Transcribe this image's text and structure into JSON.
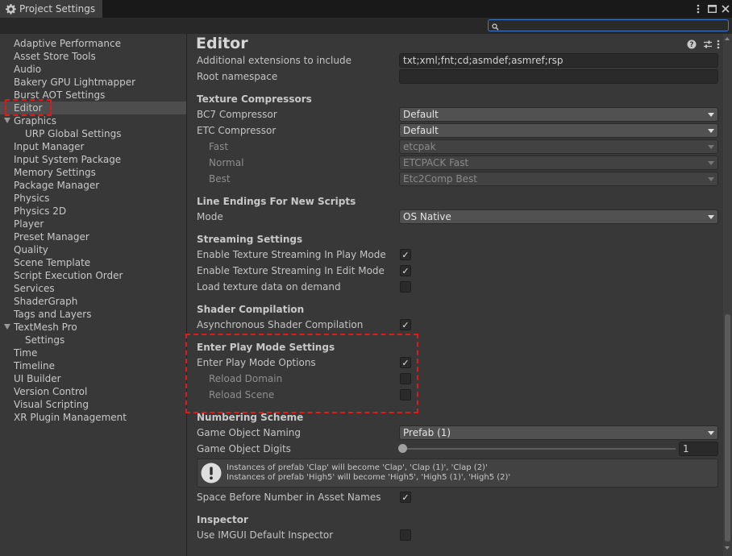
{
  "window": {
    "tab_title": "Project Settings"
  },
  "search": {
    "value": ""
  },
  "sidebar": {
    "items": [
      {
        "label": "Adaptive Performance"
      },
      {
        "label": "Asset Store Tools"
      },
      {
        "label": "Audio"
      },
      {
        "label": "Bakery GPU Lightmapper"
      },
      {
        "label": "Burst AOT Settings"
      },
      {
        "label": "Editor"
      },
      {
        "label": "Graphics"
      },
      {
        "label": "URP Global Settings"
      },
      {
        "label": "Input Manager"
      },
      {
        "label": "Input System Package"
      },
      {
        "label": "Memory Settings"
      },
      {
        "label": "Package Manager"
      },
      {
        "label": "Physics"
      },
      {
        "label": "Physics 2D"
      },
      {
        "label": "Player"
      },
      {
        "label": "Preset Manager"
      },
      {
        "label": "Quality"
      },
      {
        "label": "Scene Template"
      },
      {
        "label": "Script Execution Order"
      },
      {
        "label": "Services"
      },
      {
        "label": "ShaderGraph"
      },
      {
        "label": "Tags and Layers"
      },
      {
        "label": "TextMesh Pro"
      },
      {
        "label": "Settings"
      },
      {
        "label": "Time"
      },
      {
        "label": "Timeline"
      },
      {
        "label": "UI Builder"
      },
      {
        "label": "Version Control"
      },
      {
        "label": "Visual Scripting"
      },
      {
        "label": "XR Plugin Management"
      }
    ],
    "selected": "Editor"
  },
  "main": {
    "title": "Editor",
    "additional_extensions": {
      "label": "Additional extensions to include",
      "value": "txt;xml;fnt;cd;asmdef;asmref;rsp"
    },
    "root_namespace": {
      "label": "Root namespace",
      "value": ""
    },
    "texture_compressors": {
      "header": "Texture Compressors",
      "bc7": {
        "label": "BC7 Compressor",
        "value": "Default"
      },
      "etc": {
        "label": "ETC Compressor",
        "value": "Default"
      },
      "fast": {
        "label": "Fast",
        "value": "etcpak"
      },
      "normal": {
        "label": "Normal",
        "value": "ETCPACK Fast"
      },
      "best": {
        "label": "Best",
        "value": "Etc2Comp Best"
      }
    },
    "line_endings": {
      "header": "Line Endings For New Scripts",
      "mode": {
        "label": "Mode",
        "value": "OS Native"
      }
    },
    "streaming": {
      "header": "Streaming Settings",
      "play_mode": {
        "label": "Enable Texture Streaming In Play Mode",
        "checked": true
      },
      "edit_mode": {
        "label": "Enable Texture Streaming In Edit Mode",
        "checked": true
      },
      "load_on_demand": {
        "label": "Load texture data on demand",
        "checked": false
      }
    },
    "shader": {
      "header": "Shader Compilation",
      "async": {
        "label": "Asynchronous Shader Compilation",
        "checked": true
      }
    },
    "play_mode_settings": {
      "header": "Enter Play Mode Settings",
      "options": {
        "label": "Enter Play Mode Options",
        "checked": true
      },
      "reload_domain": {
        "label": "Reload Domain",
        "checked": false
      },
      "reload_scene": {
        "label": "Reload Scene",
        "checked": false
      }
    },
    "numbering": {
      "header": "Numbering Scheme",
      "naming": {
        "label": "Game Object Naming",
        "value": "Prefab (1)"
      },
      "digits": {
        "label": "Game Object Digits",
        "value": "1"
      },
      "help_line1": "Instances of prefab 'Clap' will become 'Clap', 'Clap (1)', 'Clap (2)'",
      "help_line2": "Instances of prefab 'High5' will become 'High5', 'High5 (1)', 'High5 (2)'",
      "space_before": {
        "label": "Space Before Number in Asset Names",
        "checked": true
      }
    },
    "inspector": {
      "header": "Inspector",
      "imgui": {
        "label": "Use IMGUI Default Inspector",
        "checked": false
      }
    }
  },
  "colors": {
    "highlight": "#e21a1a",
    "search_border": "#3d7bd0"
  }
}
